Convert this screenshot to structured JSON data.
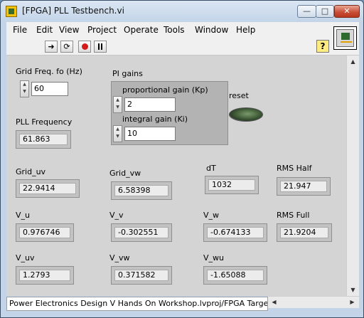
{
  "window": {
    "title": "[FPGA] PLL Testbench.vi",
    "minimize": "—",
    "maximize": "□",
    "close": "✕"
  },
  "menu": {
    "items": [
      "File",
      "Edit",
      "View",
      "Project",
      "Operate",
      "Tools",
      "Window",
      "Help"
    ]
  },
  "toolbar": {
    "run_icon": "run-arrow-icon",
    "run_cont_icon": "run-continuously-icon",
    "abort_icon": "abort-icon",
    "pause_icon": "pause-icon",
    "help_label": "?"
  },
  "controls": {
    "grid_freq": {
      "label": "Grid Freq. fo (Hz)",
      "value": "60"
    },
    "pi_gains": {
      "label": "PI gains",
      "kp": {
        "label": "proportional gain (Kp)",
        "value": "2"
      },
      "ki": {
        "label": "integral gain (Ki)",
        "value": "10"
      }
    },
    "reset": {
      "label": "reset"
    }
  },
  "indicators": {
    "pll_frequency": {
      "label": "PLL Frequency",
      "value": "61.863"
    },
    "grid_uv": {
      "label": "Grid_uv",
      "value": "22.9414"
    },
    "grid_vw": {
      "label": "Grid_vw",
      "value": "6.58398"
    },
    "dt": {
      "label": "dT",
      "value": "1032"
    },
    "rms_half": {
      "label": "RMS Half",
      "value": "21.947"
    },
    "v_u": {
      "label": "V_u",
      "value": "0.976746"
    },
    "v_v": {
      "label": "V_v",
      "value": "-0.302551"
    },
    "v_w": {
      "label": "V_w",
      "value": "-0.674133"
    },
    "rms_full": {
      "label": "RMS Full",
      "value": "21.9204"
    },
    "v_uv": {
      "label": "V_uv",
      "value": "1.2793"
    },
    "v_vw": {
      "label": "V_vw",
      "value": "0.371582"
    },
    "v_wu": {
      "label": "V_wu",
      "value": "-1.65088"
    }
  },
  "statusbar": {
    "text": "Power Electronics Design V Hands On Workshop.lvproj/FPGA Target"
  }
}
